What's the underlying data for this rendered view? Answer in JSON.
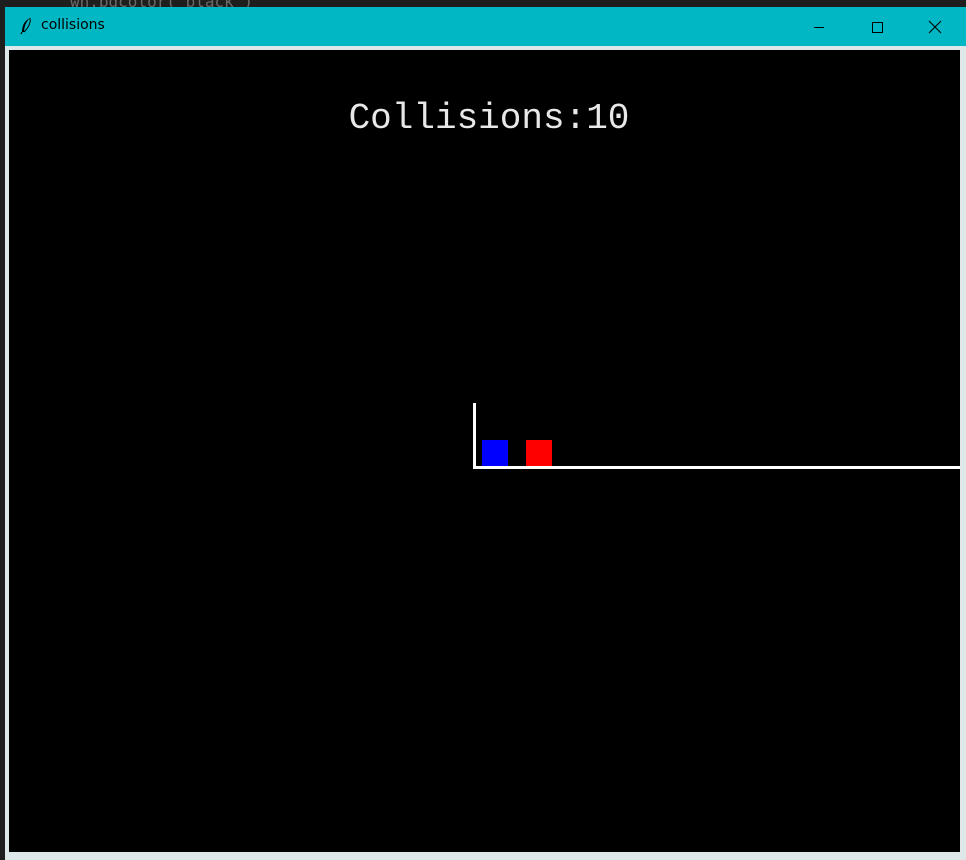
{
  "window": {
    "title": "collisions",
    "titlebar_color": "#00b7c3",
    "controls": {
      "minimize": "minimize-icon",
      "maximize": "maximize-icon",
      "close": "close-icon"
    }
  },
  "background_code": "wn.bgcolor(\"black\")",
  "scene": {
    "score_label": "Collisions:10",
    "background_color": "#000000",
    "line_color": "#ffffff",
    "block_small": {
      "color": "#0000ff"
    },
    "block_large": {
      "color": "#ff0000"
    }
  }
}
